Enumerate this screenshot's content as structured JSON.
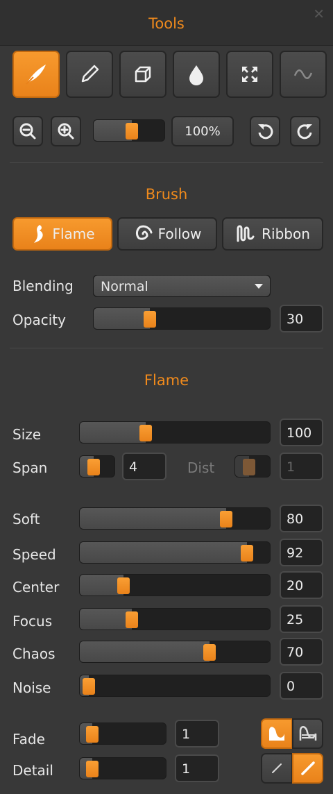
{
  "panel": {
    "title": "Tools",
    "close_glyph": "✕"
  },
  "tools": [
    {
      "name": "feather-icon",
      "active": true
    },
    {
      "name": "pencil-icon",
      "active": false
    },
    {
      "name": "eraser-icon",
      "active": false
    },
    {
      "name": "drop-icon",
      "active": false
    },
    {
      "name": "transform-arrows-icon",
      "active": false
    },
    {
      "name": "wave-icon",
      "active": false,
      "disabled": true
    }
  ],
  "view": {
    "zoom_label": "100%",
    "zoom_value": 0.55,
    "icons": [
      "zoom-out-icon",
      "zoom-in-icon",
      "rotate-left-icon",
      "rotate-right-icon"
    ]
  },
  "brush": {
    "section_title": "Brush",
    "buttons": [
      {
        "label": "Flame",
        "icon": "flame-icon",
        "active": true
      },
      {
        "label": "Follow",
        "icon": "spiral-icon",
        "active": false
      },
      {
        "label": "Ribbon",
        "icon": "ribbon-icon",
        "active": false
      }
    ],
    "blending_label": "Blending",
    "blending_value": "Normal",
    "opacity_label": "Opacity",
    "opacity_value": "30",
    "opacity_fraction": 0.3
  },
  "flame": {
    "section_title": "Flame",
    "size": {
      "label": "Size",
      "value": "100",
      "fraction": 0.33
    },
    "span": {
      "label": "Span",
      "value": "4",
      "fraction": 0.3
    },
    "dist": {
      "label": "Dist",
      "value": "1",
      "fraction": 0.3
    },
    "soft": {
      "label": "Soft",
      "value": "80",
      "fraction": 0.8
    },
    "speed": {
      "label": "Speed",
      "value": "92",
      "fraction": 0.92
    },
    "center": {
      "label": "Center",
      "value": "20",
      "fraction": 0.2
    },
    "focus": {
      "label": "Focus",
      "value": "25",
      "fraction": 0.25
    },
    "chaos": {
      "label": "Chaos",
      "value": "70",
      "fraction": 0.7
    },
    "noise": {
      "label": "Noise",
      "value": "0",
      "fraction": 0.0
    },
    "fade": {
      "label": "Fade",
      "value": "1",
      "fraction": 0.05
    },
    "detail": {
      "label": "Detail",
      "value": "1",
      "fraction": 0.05
    }
  },
  "colors": {
    "accent": "#f08a1c",
    "panel": "#383838",
    "track": "#202020"
  }
}
